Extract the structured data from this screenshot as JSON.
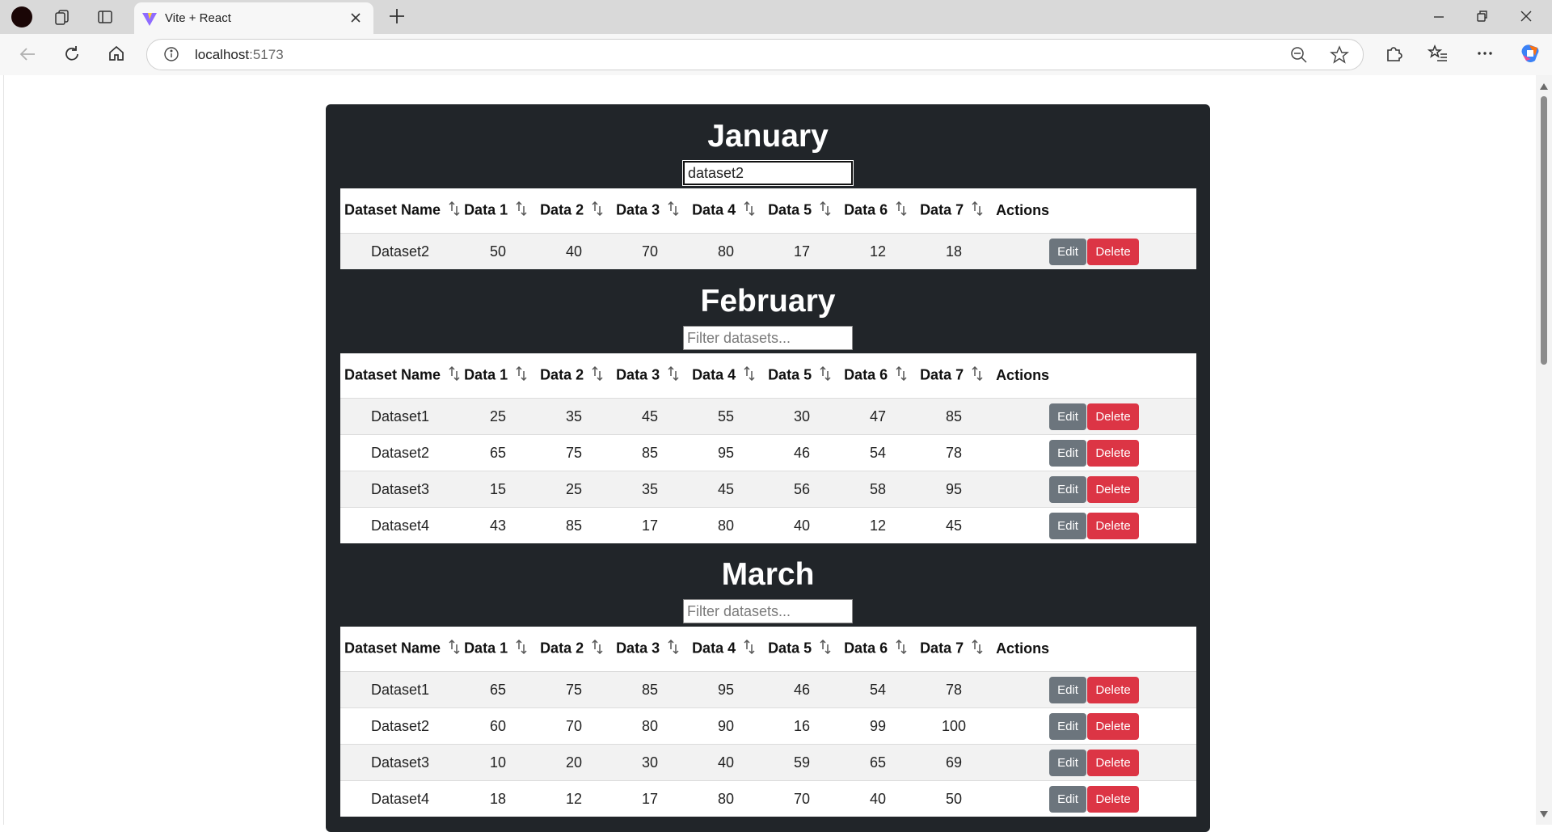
{
  "browser": {
    "tab_title": "Vite + React",
    "url_host": "localhost",
    "url_port": ":5173"
  },
  "table_headers": [
    "Dataset Name",
    "Data 1",
    "Data 2",
    "Data 3",
    "Data 4",
    "Data 5",
    "Data 6",
    "Data 7"
  ],
  "actions_header": "Actions",
  "edit_label": "Edit",
  "delete_label": "Delete",
  "filter_placeholder": "Filter datasets...",
  "months": [
    {
      "title": "January",
      "filter_value": "dataset2",
      "rows": [
        [
          "Dataset2",
          "50",
          "40",
          "70",
          "80",
          "17",
          "12",
          "18"
        ]
      ]
    },
    {
      "title": "February",
      "filter_value": "",
      "rows": [
        [
          "Dataset1",
          "25",
          "35",
          "45",
          "55",
          "30",
          "47",
          "85"
        ],
        [
          "Dataset2",
          "65",
          "75",
          "85",
          "95",
          "46",
          "54",
          "78"
        ],
        [
          "Dataset3",
          "15",
          "25",
          "35",
          "45",
          "56",
          "58",
          "95"
        ],
        [
          "Dataset4",
          "43",
          "85",
          "17",
          "80",
          "40",
          "12",
          "45"
        ]
      ]
    },
    {
      "title": "March",
      "filter_value": "",
      "rows": [
        [
          "Dataset1",
          "65",
          "75",
          "85",
          "95",
          "46",
          "54",
          "78"
        ],
        [
          "Dataset2",
          "60",
          "70",
          "80",
          "90",
          "16",
          "99",
          "100"
        ],
        [
          "Dataset3",
          "10",
          "20",
          "30",
          "40",
          "59",
          "65",
          "69"
        ],
        [
          "Dataset4",
          "18",
          "12",
          "17",
          "80",
          "70",
          "40",
          "50"
        ]
      ]
    }
  ],
  "colors": {
    "panel_bg": "#212529",
    "edit_button": "#6c757d",
    "delete_button": "#dc3545"
  }
}
